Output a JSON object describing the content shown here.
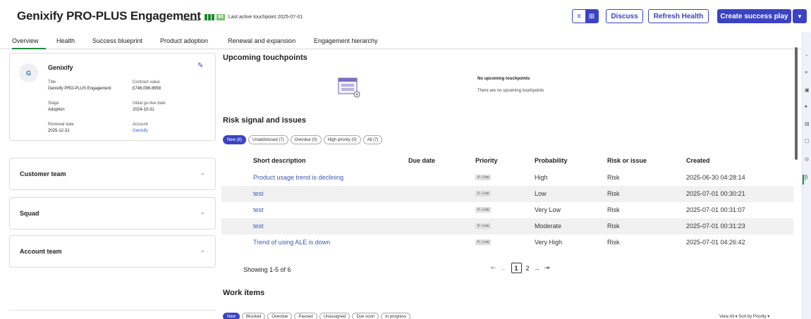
{
  "header": {
    "title": "Genixify PRO-PLUS Engagement",
    "health_score": "95",
    "last_touchpoint": "Last active touchpoint 2025-07-01",
    "buttons": {
      "discuss": "Discuss",
      "refresh": "Refresh Health",
      "create": "Create success play"
    }
  },
  "tabs": [
    "Overview",
    "Health",
    "Success blueprint",
    "Product adoption",
    "Renewal and expansion",
    "Engagement hierarchy"
  ],
  "account": {
    "name": "Genixify",
    "logo_text": "G",
    "fields": {
      "title_label": "Title",
      "title_value": "Genixify PRO-PLUS Engagement",
      "contract_label": "Contract value",
      "contract_value": "£746,096.8958",
      "stage_label": "Stage",
      "stage_value": "Adoption",
      "golive_label": "Initial go-live date",
      "golive_value": "2024-10-31",
      "renewal_label": "Renewal date",
      "renewal_value": "2025-12-31",
      "account_label": "Account",
      "account_value": "Genixify"
    }
  },
  "sections": [
    "Customer team",
    "Squad",
    "Account team"
  ],
  "touchpoints": {
    "title": "Upcoming touchpoints",
    "empty_title": "No upcoming touchpoints",
    "empty_sub": "There are no upcoming touchpoints"
  },
  "risks": {
    "title": "Risk signal and issues",
    "chips": [
      "New (6)",
      "Unaddressed (7)",
      "Overdue (0)",
      "High priority (0)",
      "All (7)"
    ],
    "columns": [
      "Short description",
      "Due date",
      "Priority",
      "Probability",
      "Risk or issue",
      "Created"
    ],
    "rows": [
      {
        "desc": "Product usage trend is declining",
        "due": "",
        "priority": "4 - Low",
        "probability": "High",
        "type": "Risk",
        "created": "2025-06-30 04:28:14"
      },
      {
        "desc": "test",
        "due": "",
        "priority": "4 - Low",
        "probability": "Low",
        "type": "Risk",
        "created": "2025-07-01 00:30:21"
      },
      {
        "desc": "test",
        "due": "",
        "priority": "4 - Low",
        "probability": "Very Low",
        "type": "Risk",
        "created": "2025-07-01 00:31:07"
      },
      {
        "desc": "test",
        "due": "",
        "priority": "4 - Low",
        "probability": "Moderate",
        "type": "Risk",
        "created": "2025-07-01 00:31:23"
      },
      {
        "desc": "Trend of using ALE is down",
        "due": "",
        "priority": "4 - Low",
        "probability": "Very High",
        "type": "Risk",
        "created": "2025-07-01 04:26:42"
      }
    ],
    "showing": "Showing 1-5 of 6",
    "pages": [
      "1",
      "2"
    ]
  },
  "work_items": {
    "title": "Work items",
    "chips": [
      "New",
      "Blocked",
      "Overdue",
      "Paused",
      "Unassigned",
      "Due soon",
      "In progress"
    ],
    "view_all": "View All ▾ Sort by Priority ▾"
  },
  "colors": {
    "accent": "#3b43c4",
    "active_tab": "#1c8b3e",
    "health": "#1e8a2e",
    "link": "#3b5ab8"
  }
}
